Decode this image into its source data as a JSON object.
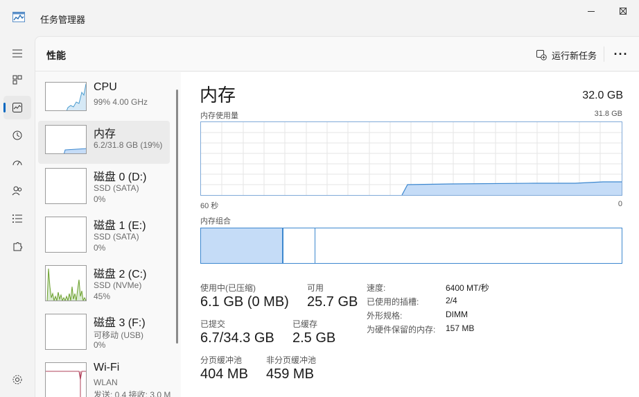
{
  "window": {
    "title": "任务管理器"
  },
  "header": {
    "title": "性能",
    "run_task_label": "运行新任务",
    "more_label": "···"
  },
  "colors": {
    "accent": "#0067c0",
    "memory_blue": "#3c87cf",
    "memory_fill": "#c5dcf7",
    "cpu_line": "#4a9ccf",
    "disk_green": "#6a9f2a",
    "wifi_red": "#b0405a"
  },
  "devices": [
    {
      "name": "CPU",
      "line1": "99% 4.00 GHz",
      "line2": ""
    },
    {
      "name": "内存",
      "line1": "6.2/31.8 GB (19%)",
      "line2": ""
    },
    {
      "name": "磁盘 0 (D:)",
      "line1": "SSD (SATA)",
      "line2": "0%"
    },
    {
      "name": "磁盘 1 (E:)",
      "line1": "SSD (SATA)",
      "line2": "0%"
    },
    {
      "name": "磁盘 2 (C:)",
      "line1": "SSD (NVMe)",
      "line2": "45%"
    },
    {
      "name": "磁盘 3 (F:)",
      "line1": "可移动 (USB)",
      "line2": "0%"
    },
    {
      "name": "Wi-Fi",
      "line1": "WLAN",
      "line2": "发送: 0.4 接收: 3.0 M"
    }
  ],
  "detail": {
    "title": "内存",
    "total": "32.0 GB",
    "usage_label": "内存使用量",
    "usage_max": "31.8 GB",
    "axis_left": "60 秒",
    "axis_right": "0",
    "composition_label": "内存组合",
    "usage_fraction": 0.194,
    "stats": {
      "in_use_label": "使用中(已压缩)",
      "in_use_value": "6.1 GB (0 MB)",
      "available_label": "可用",
      "available_value": "25.7 GB",
      "committed_label": "已提交",
      "committed_value": "6.7/34.3 GB",
      "cached_label": "已缓存",
      "cached_value": "2.5 GB",
      "paged_label": "分页缓冲池",
      "paged_value": "404 MB",
      "nonpaged_label": "非分页缓冲池",
      "nonpaged_value": "459 MB"
    },
    "specs": [
      {
        "key": "速度:",
        "value": "6400 MT/秒"
      },
      {
        "key": "已使用的插槽:",
        "value": "2/4"
      },
      {
        "key": "外形规格:",
        "value": "DIMM"
      },
      {
        "key": "为硬件保留的内存:",
        "value": "157 MB"
      }
    ]
  }
}
